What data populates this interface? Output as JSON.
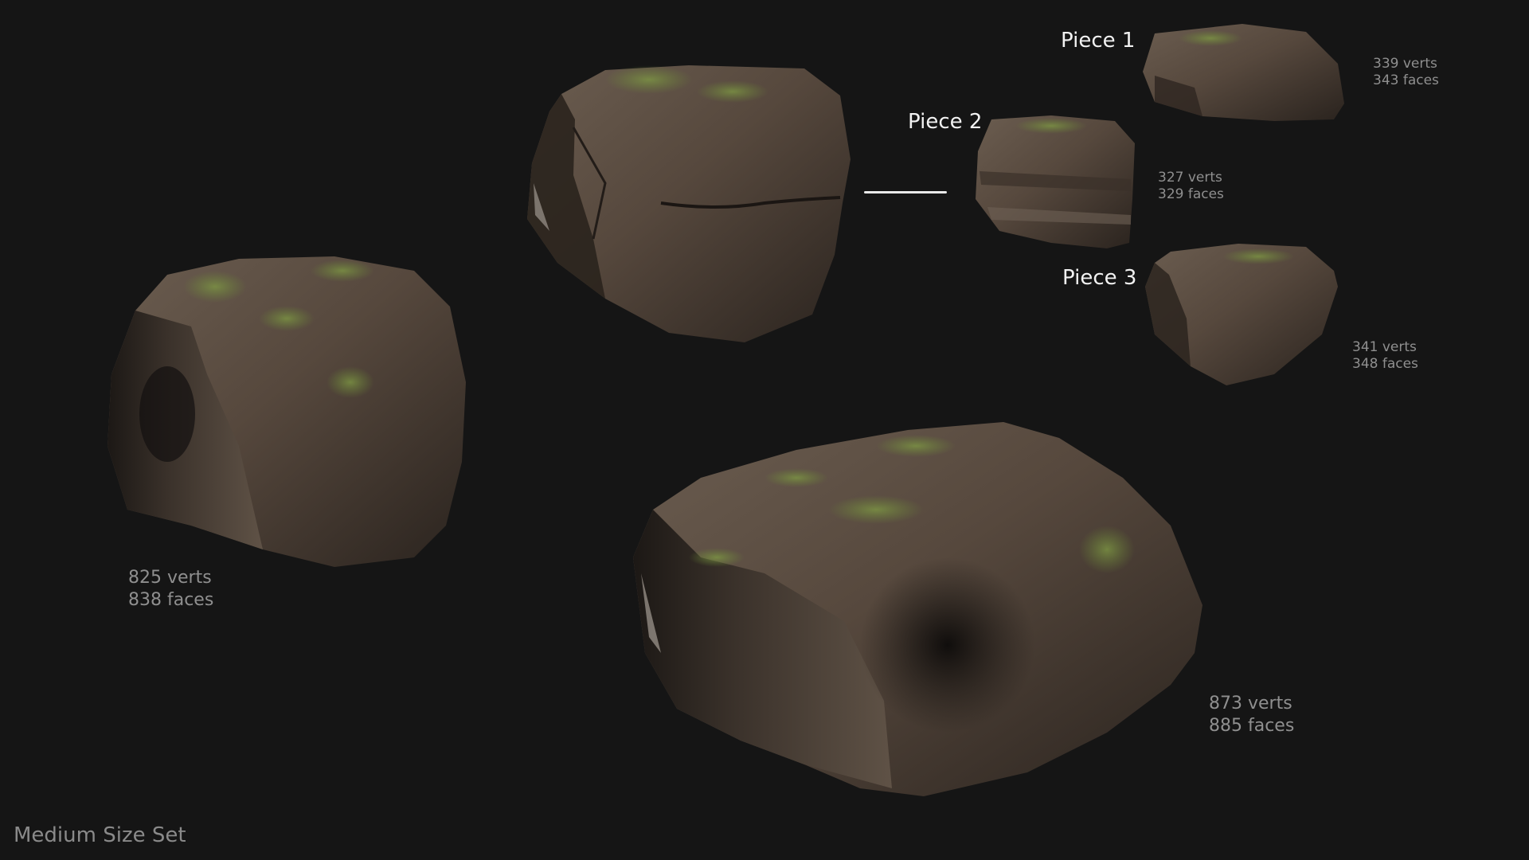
{
  "set_title": "Medium Size Set",
  "pieces": [
    {
      "label": "Piece 1",
      "verts": "339 verts",
      "faces": "343 faces"
    },
    {
      "label": "Piece 2",
      "verts": "327 verts",
      "faces": "329 faces"
    },
    {
      "label": "Piece 3",
      "verts": "341 verts",
      "faces": "348 faces"
    }
  ],
  "rocks": [
    {
      "verts": "825 verts",
      "faces": "838 faces"
    },
    {
      "verts": "873 verts",
      "faces": "885 faces"
    }
  ],
  "colors": {
    "background": "#151515",
    "rock_base": "#5b4d42",
    "moss": "#6f8a3a",
    "label": "#f2f2f2",
    "stat_text": "#8f8f8f"
  }
}
